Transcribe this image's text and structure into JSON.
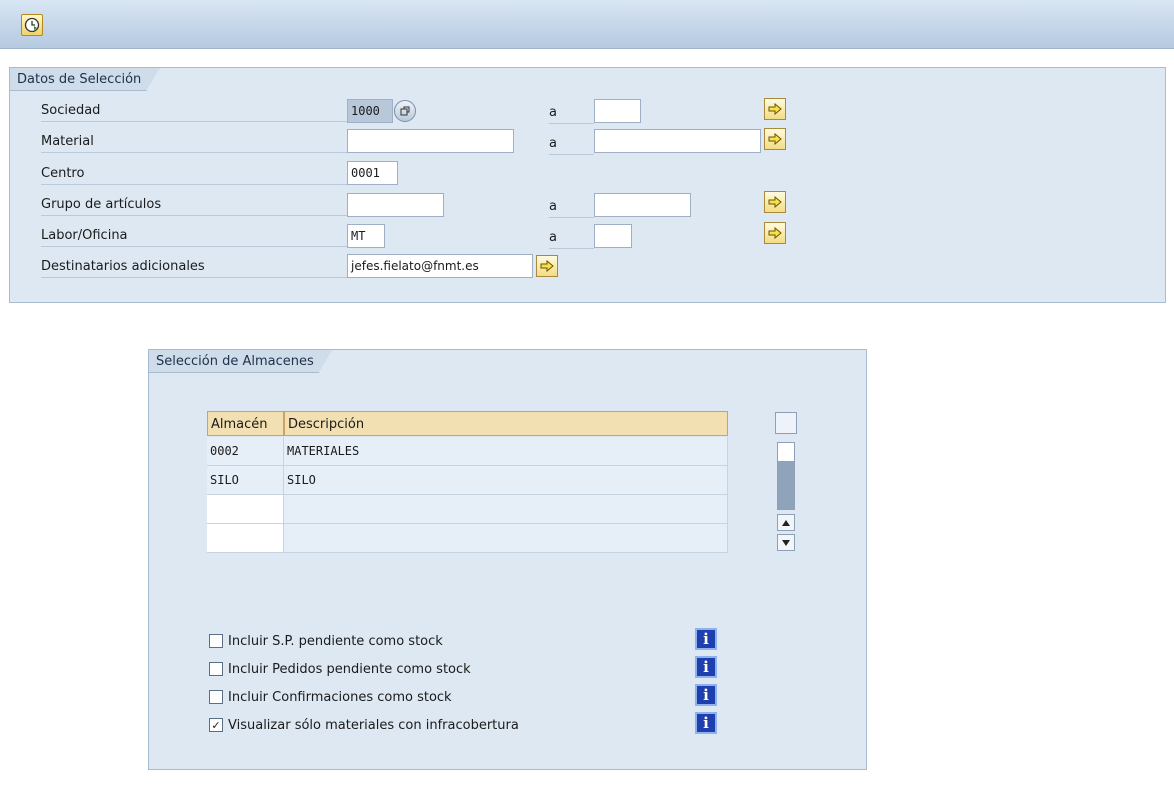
{
  "toolbar": {
    "execute_icon": "clock-execute-icon"
  },
  "selection_box": {
    "title": "Datos de Selección",
    "range_label": "a",
    "fields": [
      {
        "label": "Sociedad",
        "from_value": "1000",
        "to_value": ""
      },
      {
        "label": "Material",
        "from_value": "",
        "to_value": ""
      },
      {
        "label": "Centro",
        "from_value": "0001"
      },
      {
        "label": "Grupo de artículos",
        "from_value": "",
        "to_value": ""
      },
      {
        "label": "Labor/Oficina",
        "from_value": "MT",
        "to_value": ""
      },
      {
        "label": "Destinatarios adicionales",
        "from_value": "jefes.fielato@fnmt.es"
      }
    ]
  },
  "warehouse_box": {
    "title": "Selección de Almacenes",
    "table": {
      "columns": [
        "Almacén",
        "Descripción"
      ],
      "rows": [
        [
          "0002",
          "MATERIALES"
        ],
        [
          "SILO",
          "SILO"
        ],
        [
          "",
          ""
        ],
        [
          "",
          ""
        ]
      ]
    },
    "options": [
      {
        "label": "Incluir S.P. pendiente como stock",
        "checked": false
      },
      {
        "label": "Incluir Pedidos pendiente como stock",
        "checked": false
      },
      {
        "label": "Incluir Confirmaciones como stock",
        "checked": false
      },
      {
        "label": "Visualizar sólo materiales con infracobertura",
        "checked": true
      }
    ],
    "checked_mark": "✓",
    "info_icon": "i"
  },
  "colors": {
    "header_bar": "#b5c9e0",
    "frame_bg": "#dde8f3",
    "table_header": "#f2dfb2",
    "info_button": "#1e3fae"
  }
}
